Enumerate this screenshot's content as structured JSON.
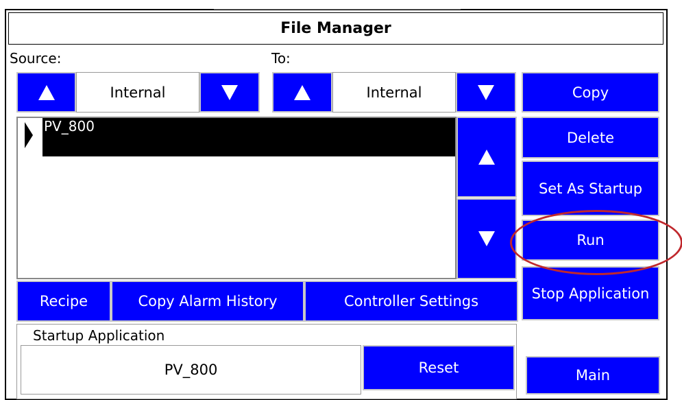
{
  "title": "File Manager",
  "source": {
    "label": "Source:",
    "value": "Internal"
  },
  "to": {
    "label": "To:",
    "value": "Internal"
  },
  "file_list": {
    "items": [
      "PV_800"
    ]
  },
  "buttons": {
    "copy": "Copy",
    "delete": "Delete",
    "set_as_startup": "Set As Startup",
    "run": "Run",
    "stop_application": "Stop Application",
    "recipe": "Recipe",
    "copy_alarm_history": "Copy Alarm History",
    "controller_settings": "Controller Settings",
    "reset": "Reset",
    "main": "Main"
  },
  "startup": {
    "label": "Startup Application",
    "value": "PV_800"
  },
  "colors": {
    "button_blue": "#0000ff",
    "highlight_circle": "#c0282d",
    "selection": "#000000"
  }
}
